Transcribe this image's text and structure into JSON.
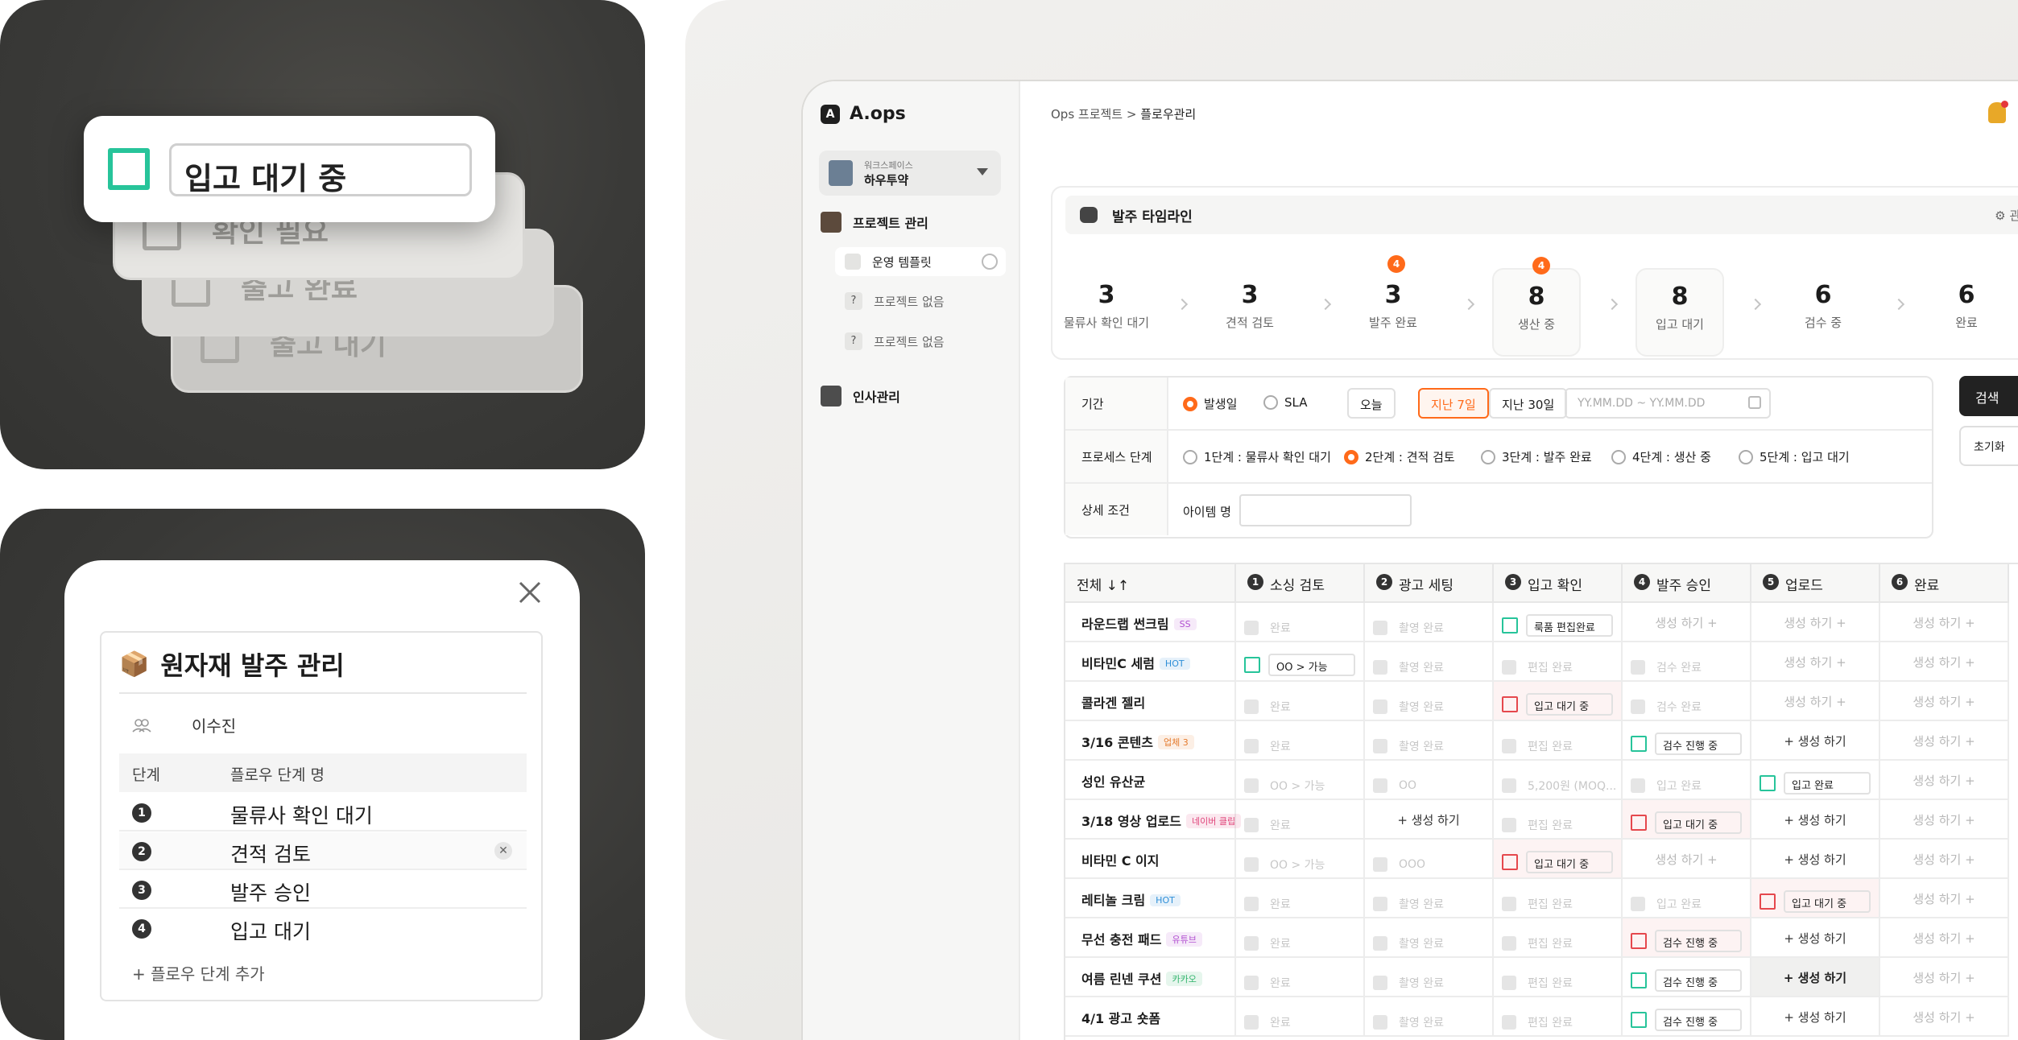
{
  "left_top": {
    "stack_cards": [
      "확인 필요",
      "출고 완료",
      "출고 대기"
    ],
    "front_card_value": "입고 대기 중"
  },
  "modal": {
    "title": "원자재 발주 관리",
    "title_icon": "📦",
    "assignee": "이수진",
    "table_header": {
      "col1": "단계",
      "col2": "플로우 단계 명"
    },
    "steps": [
      {
        "num": "1",
        "name": "물류사 확인 대기"
      },
      {
        "num": "2",
        "name": "견적 검토"
      },
      {
        "num": "3",
        "name": "발주 승인"
      },
      {
        "num": "4",
        "name": "입고 대기"
      }
    ],
    "add_step_label": "+ 플로우 단계 추가"
  },
  "sidebar": {
    "logo": "A.ops",
    "workspace_caption": "워크스페이스",
    "workspace_name": "하우투약",
    "project_menu": "프로젝트 관리",
    "template_item": "운영 템플릿",
    "empty_projects": [
      "프로젝트 없음",
      "프로젝트 없음"
    ],
    "hr_menu": "인사관리"
  },
  "breadcrumb": {
    "parent": "Ops 프로젝트 > ",
    "current": "플로우관리"
  },
  "timeline": {
    "title": "발주 타임라인",
    "manage_label": "관리",
    "steps": [
      {
        "value": "3",
        "label": "물류사 확인 대기",
        "badge": ""
      },
      {
        "value": "3",
        "label": "견적 검토",
        "badge": ""
      },
      {
        "value": "3",
        "label": "발주 완료",
        "badge": "4"
      },
      {
        "value": "8",
        "label": "생산 중",
        "badge": "4"
      },
      {
        "value": "8",
        "label": "입고 대기",
        "badge": ""
      },
      {
        "value": "6",
        "label": "검수 중",
        "badge": ""
      },
      {
        "value": "6",
        "label": "완료",
        "badge": ""
      }
    ]
  },
  "filters": {
    "period_label": "기간",
    "date_type_options": [
      "발생일",
      "SLA"
    ],
    "range_buttons": [
      "오늘",
      "지난 7일",
      "지난 30일"
    ],
    "date_placeholder": "YY.MM.DD ~ YY.MM.DD",
    "process_label": "프로세스 단계",
    "process_options": [
      "1단계 : 물류사 확인 대기",
      "2단계 : 견적 검토",
      "3단계 : 발주 완료",
      "4단계 : 생산 중",
      "5단계 : 입고 대기"
    ],
    "detail_label": "상세 조건",
    "item_name_label": "아이템 명",
    "search_button": "검색",
    "reset_button": "초기화"
  },
  "grid": {
    "all_label": "전체 ↓↑",
    "columns": [
      {
        "num": "1",
        "label": "소싱 검토"
      },
      {
        "num": "2",
        "label": "광고 세팅"
      },
      {
        "num": "3",
        "label": "입고 확인"
      },
      {
        "num": "4",
        "label": "발주 승인"
      },
      {
        "num": "5",
        "label": "업로드"
      },
      {
        "num": "6",
        "label": "완료"
      }
    ],
    "rows": [
      {
        "name": "라운드랩 썬크림",
        "tag": "SS",
        "tag_color": "#b14fd1",
        "cells": [
          [
            "done",
            "완료"
          ],
          [
            "done",
            "촬영 완료"
          ],
          [
            "act",
            "룩품 편집완료",
            "green"
          ],
          [
            "gen",
            "생성 하기 +"
          ],
          [
            "gen",
            "생성 하기 +"
          ],
          [
            "gen",
            "생성 하기 +"
          ]
        ]
      },
      {
        "name": "비타민C 세럼",
        "tag": "HOT",
        "tag_color": "#2f8fd8",
        "cells": [
          [
            "act",
            "OO > 가능",
            "green"
          ],
          [
            "done",
            "촬영 완료"
          ],
          [
            "done",
            "편집 완료"
          ],
          [
            "done",
            "검수 완료"
          ],
          [
            "gen",
            "생성 하기 +"
          ],
          [
            "gen",
            "생성 하기 +"
          ]
        ]
      },
      {
        "name": "콜라겐 젤리",
        "tag": "",
        "tag_color": "",
        "cells": [
          [
            "done",
            "완료"
          ],
          [
            "done",
            "촬영 완료"
          ],
          [
            "act",
            "입고 대기 중",
            "red"
          ],
          [
            "done",
            "검수 완료"
          ],
          [
            "gen",
            "생성 하기 +"
          ],
          [
            "gen",
            "생성 하기 +"
          ]
        ]
      },
      {
        "name": "3/16 콘텐츠",
        "tag": "업체 3",
        "tag_color": "#e57a2c",
        "cells": [
          [
            "done",
            "완료"
          ],
          [
            "done",
            "촬영 완료"
          ],
          [
            "done",
            "편집 완료"
          ],
          [
            "act",
            "검수 진행 중",
            "green"
          ],
          [
            "gen",
            "+ 생성 하기",
            "dark"
          ],
          [
            "gen",
            "생성 하기 +"
          ]
        ]
      },
      {
        "name": "성인 유산균",
        "tag": "",
        "tag_color": "",
        "cells": [
          [
            "done",
            "OO > 가능"
          ],
          [
            "done",
            "OO"
          ],
          [
            "done",
            "5,200원 (MOQ..."
          ],
          [
            "done",
            "입고 완료"
          ],
          [
            "act",
            "입고 완료",
            "green"
          ],
          [
            "gen",
            "생성 하기 +"
          ]
        ]
      },
      {
        "name": "3/18 영상 업로드",
        "tag": "네이버 클립",
        "tag_color": "#e0457b",
        "cells": [
          [
            "done",
            "완료"
          ],
          [
            "gen",
            "+ 생성 하기",
            "dark"
          ],
          [
            "done",
            "편집 완료"
          ],
          [
            "act",
            "입고 대기 중",
            "red"
          ],
          [
            "gen",
            "+ 생성 하기",
            "dark"
          ],
          [
            "gen",
            "생성 하기 +"
          ]
        ]
      },
      {
        "name": "비타민 C 이지",
        "tag": "",
        "tag_color": "",
        "cells": [
          [
            "done",
            "OO > 가능"
          ],
          [
            "done",
            "OOO"
          ],
          [
            "act",
            "입고 대기 중",
            "red"
          ],
          [
            "gen",
            "생성 하기 +"
          ],
          [
            "gen",
            "+ 생성 하기",
            "dark"
          ],
          [
            "gen",
            "생성 하기 +"
          ]
        ]
      },
      {
        "name": "레티놀 크림",
        "tag": "HOT",
        "tag_color": "#2f8fd8",
        "cells": [
          [
            "done",
            "완료"
          ],
          [
            "done",
            "촬영 완료"
          ],
          [
            "done",
            "편집 완료"
          ],
          [
            "done",
            "입고 완료"
          ],
          [
            "act",
            "입고 대기 중",
            "red"
          ],
          [
            "gen",
            "생성 하기 +"
          ]
        ]
      },
      {
        "name": "무선 충전 패드",
        "tag": "유튜브",
        "tag_color": "#b14fd1",
        "cells": [
          [
            "done",
            "완료"
          ],
          [
            "done",
            "촬영 완료"
          ],
          [
            "done",
            "편집 완료"
          ],
          [
            "act",
            "검수 진행 중",
            "red"
          ],
          [
            "gen",
            "+ 생성 하기",
            "dark"
          ],
          [
            "gen",
            "생성 하기 +"
          ]
        ]
      },
      {
        "name": "여름 린넨 쿠션",
        "tag": "카카오",
        "tag_color": "#2fb36b",
        "cells": [
          [
            "done",
            "완료"
          ],
          [
            "done",
            "촬영 완료"
          ],
          [
            "done",
            "편집 완료"
          ],
          [
            "act",
            "검수 진행 중",
            "green"
          ],
          [
            "gen",
            "+ 생성 하기",
            "hi"
          ],
          [
            "gen",
            "생성 하기 +"
          ]
        ]
      },
      {
        "name": "4/1 광고 숏폼",
        "tag": "",
        "tag_color": "",
        "cells": [
          [
            "done",
            "완료"
          ],
          [
            "done",
            "촬영 완료"
          ],
          [
            "done",
            "편집 완료"
          ],
          [
            "act",
            "검수 진행 중",
            "green"
          ],
          [
            "gen",
            "+ 생성 하기",
            "dark"
          ],
          [
            "gen",
            "생성 하기 +"
          ]
        ]
      }
    ]
  },
  "colors": {
    "accent": "#ff6a1a",
    "green": "#27c49a",
    "red": "#e5484d"
  }
}
